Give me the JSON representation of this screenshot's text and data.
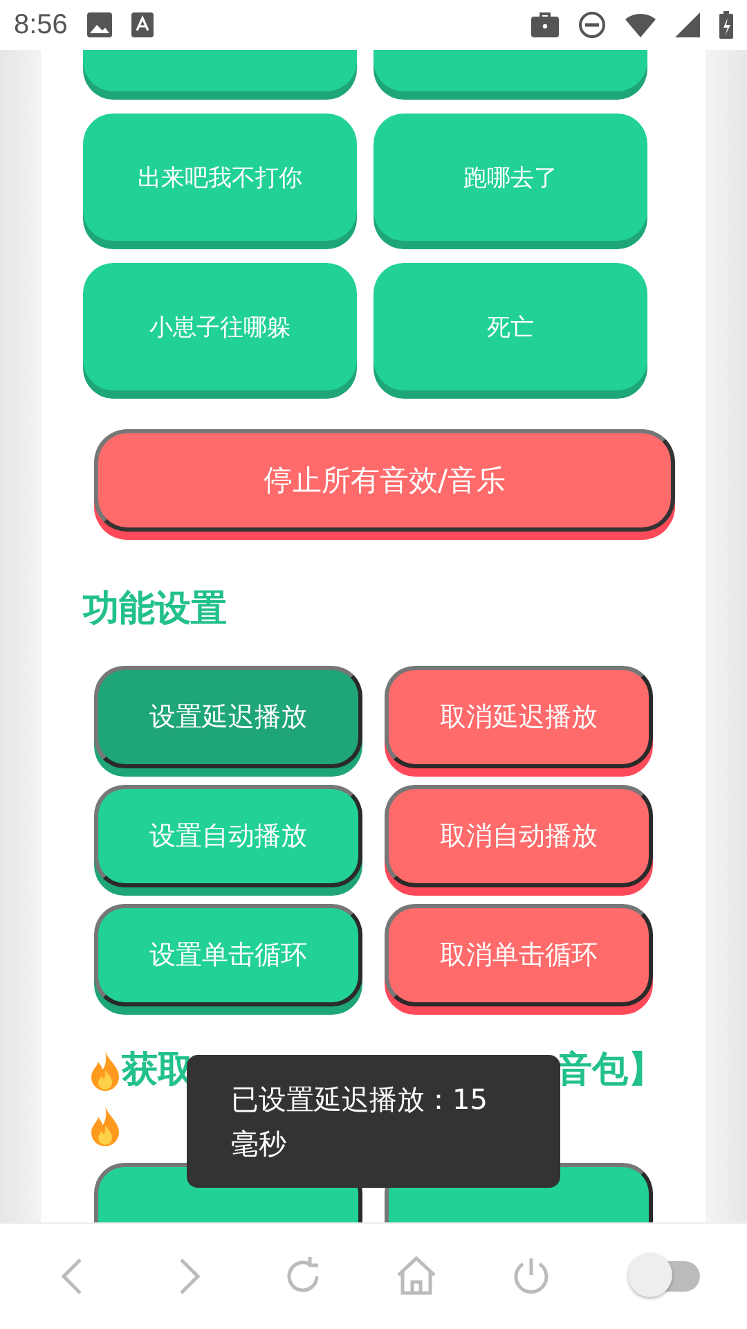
{
  "status_bar": {
    "time": "8:56"
  },
  "sound_buttons": [
    {
      "label": "出来吧我不打你"
    },
    {
      "label": "跑哪去了"
    },
    {
      "label": "小崽子往哪躲"
    },
    {
      "label": "死亡"
    }
  ],
  "stop_button": {
    "label": "停止所有音效/音乐"
  },
  "settings_heading": "功能设置",
  "settings_buttons": [
    {
      "label": "设置延迟播放",
      "kind": "set",
      "selected": true
    },
    {
      "label": "取消延迟播放",
      "kind": "cancel",
      "selected": false
    },
    {
      "label": "设置自动播放",
      "kind": "set",
      "selected": false
    },
    {
      "label": "取消自动播放",
      "kind": "cancel",
      "selected": false
    },
    {
      "label": "设置单击循环",
      "kind": "set",
      "selected": false
    },
    {
      "label": "取消单击循环",
      "kind": "cancel",
      "selected": false
    }
  ],
  "promo_heading": {
    "left": "获取",
    "right": "音包】"
  },
  "toast": {
    "text": "已设置延迟播放：15毫秒"
  },
  "bottom_bar": {
    "toggle": {
      "on": false
    }
  }
}
